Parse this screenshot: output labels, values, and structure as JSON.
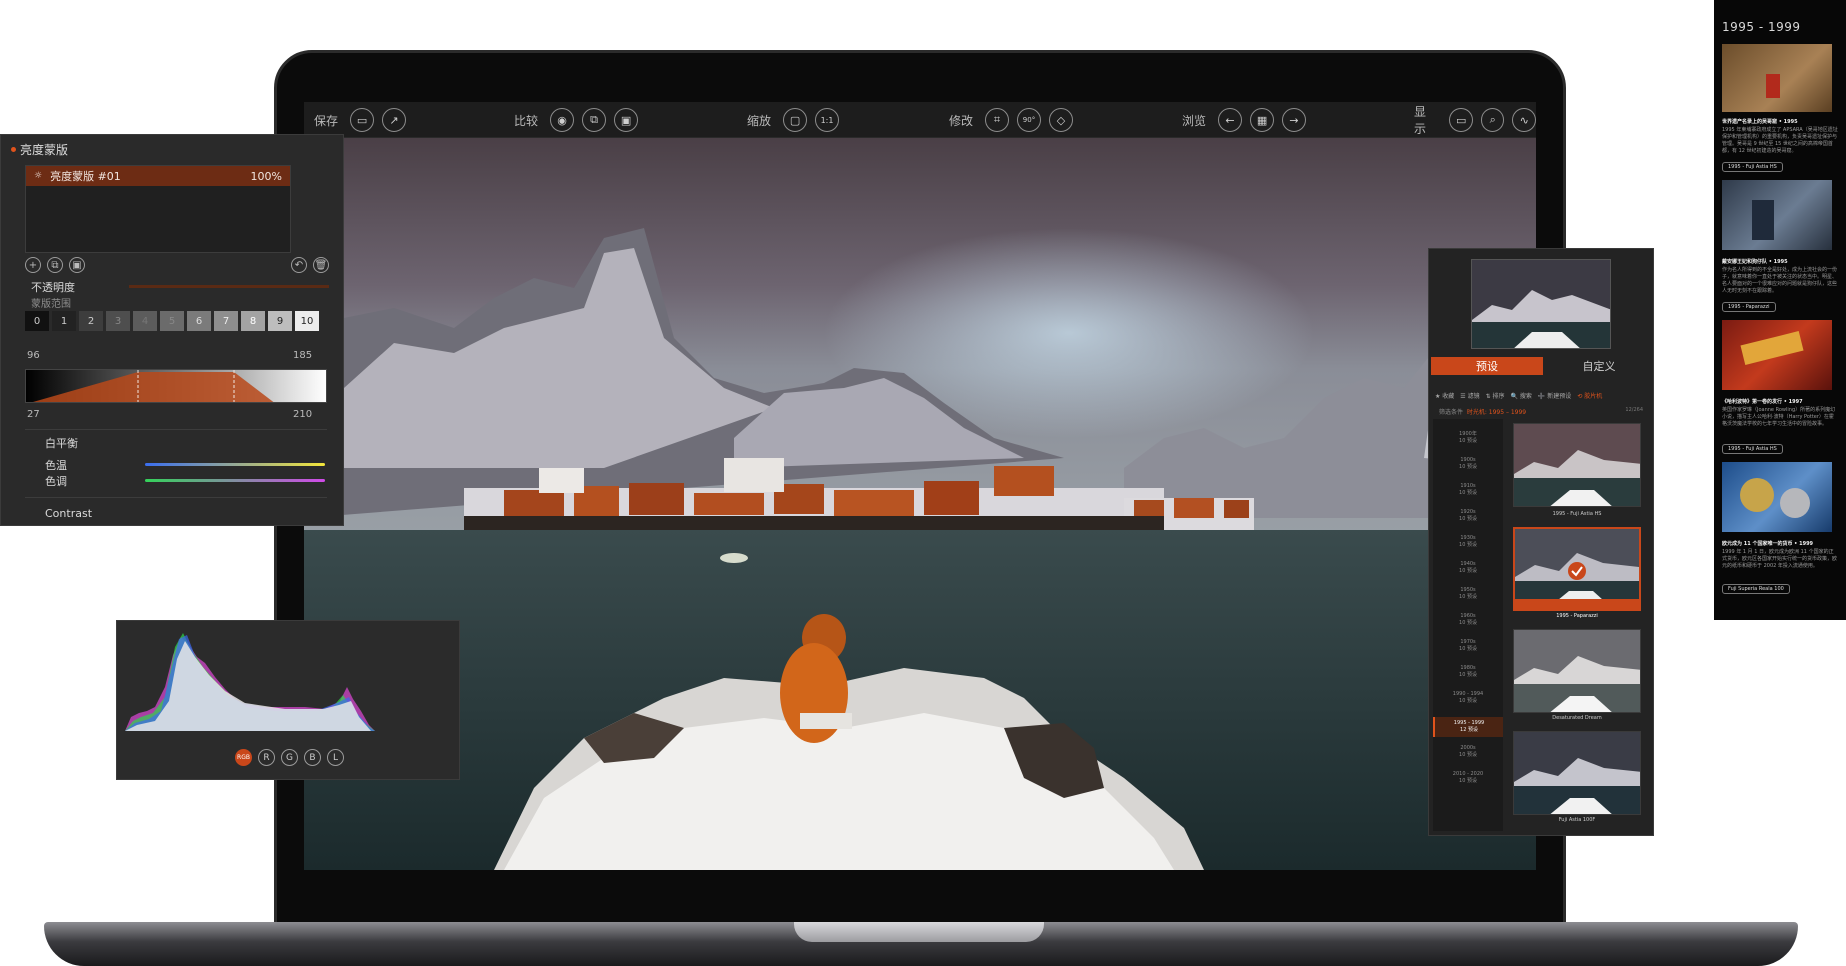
{
  "toolbar": {
    "save_label": "保存",
    "compare_label": "比较",
    "zoom_label": "缩放",
    "zoom_value": "1:1",
    "modify_label": "修改",
    "rotate_value": "90°",
    "browse_label": "浏览",
    "display_label": "显示"
  },
  "luminosity_mask": {
    "panel_title": "亮度蒙版",
    "mask_name": "亮度蒙版 #01",
    "mask_opacity": "100%",
    "opacity_label": "不透明度",
    "range_label": "蒙版范围",
    "range_cells": [
      "0",
      "1",
      "2",
      "3",
      "4",
      "5",
      "6",
      "7",
      "8",
      "9",
      "10"
    ],
    "range_top_left": "96",
    "range_top_right": "185",
    "range_bottom_left": "27",
    "range_bottom_right": "210",
    "white_balance_label": "白平衡",
    "temperature_label": "色温",
    "tint_label": "色调",
    "contrast_label": "Contrast"
  },
  "histogram": {
    "channels": [
      "RGB",
      "R",
      "G",
      "B",
      "L"
    ],
    "active_channel": "RGB"
  },
  "presets": {
    "tab_presets": "预设",
    "tab_custom": "自定义",
    "filters": [
      "★ 收藏",
      "☰ 滤镜",
      "⇅ 排序",
      "🔍 搜索",
      "➕ 新建预设",
      "⟲ 胶片机"
    ],
    "crumb_label": "筛选条件",
    "crumb_value": "时光机: 1995 – 1999",
    "count": "12/264",
    "years": [
      {
        "year": "1900年",
        "count": "10 预设"
      },
      {
        "year": "1900s",
        "count": "10 预设"
      },
      {
        "year": "1910s",
        "count": "10 预设"
      },
      {
        "year": "1920s",
        "count": "10 预设"
      },
      {
        "year": "1930s",
        "count": "10 预设"
      },
      {
        "year": "1940s",
        "count": "10 预设"
      },
      {
        "year": "1950s",
        "count": "10 预设"
      },
      {
        "year": "1960s",
        "count": "10 预设"
      },
      {
        "year": "1970s",
        "count": "10 预设"
      },
      {
        "year": "1980s",
        "count": "10 预设"
      },
      {
        "year": "1990 - 1994",
        "count": "10 预设"
      },
      {
        "year": "1995 - 1999",
        "count": "12 预设"
      },
      {
        "year": "2000s",
        "count": "10 预设"
      },
      {
        "year": "2010 - 2020",
        "count": "10 预设"
      }
    ],
    "tiles": [
      "1995 - Fuji Astia HS",
      "1995 - Paparazzi",
      "Desaturated Dream",
      "Fuji Astia 100F"
    ]
  },
  "timeline": {
    "title": "1995 - 1999",
    "entries": [
      {
        "caption": "世界遗产名录上的吴哥窟 • 1995",
        "text": "1995 年柬埔寨政府成立了 APSARA（吴哥地区遗址保护和管理机构）的重要机构，负责吴哥遗址保护与管理。吴哥是 9 世纪至 15 世纪之间的高棉帝国首都，有 12 世纪初建造的吴哥窟。",
        "tag": "1995 - Fuji Astia HS"
      },
      {
        "caption": "戴安娜王妃和狗仔队 • 1995",
        "text": "作为名人所得到的不全是好处，成为上流社会的一份子，就意味着你一直处于被关注的状态当中。明星、名人要面对的一个很难应对的问题就是狗仔队，这些人无时无刻不在跟踪着。",
        "tag": "1995 - Paparazzi"
      },
      {
        "caption": "《哈利波特》第一卷的发行 • 1997",
        "text": "英国作家罗琳（Joanne Rowling）所著的系列魔幻小说，描写主人公哈利·波特（Harry Potter）在霍格沃茨魔法学校的七年学习生活中的冒险故事。",
        "tag": "1995 - Fuji Astia HS"
      },
      {
        "caption": "欧元成为 11 个国家唯一的货币 • 1999",
        "text": "1999 年 1 月 1 日，欧元成为欧洲 11 个国家的正式货币，欧元区各国家开始实行统一的货币政策，欧元的纸币和硬币于 2002 年投入流通使用。",
        "tag": "Fuji Superia Reala 100"
      }
    ]
  },
  "colors": {
    "accent": "#c9471a",
    "panel_bg": "#2a2a2a",
    "toolbar_bg": "#1d1d1d"
  }
}
